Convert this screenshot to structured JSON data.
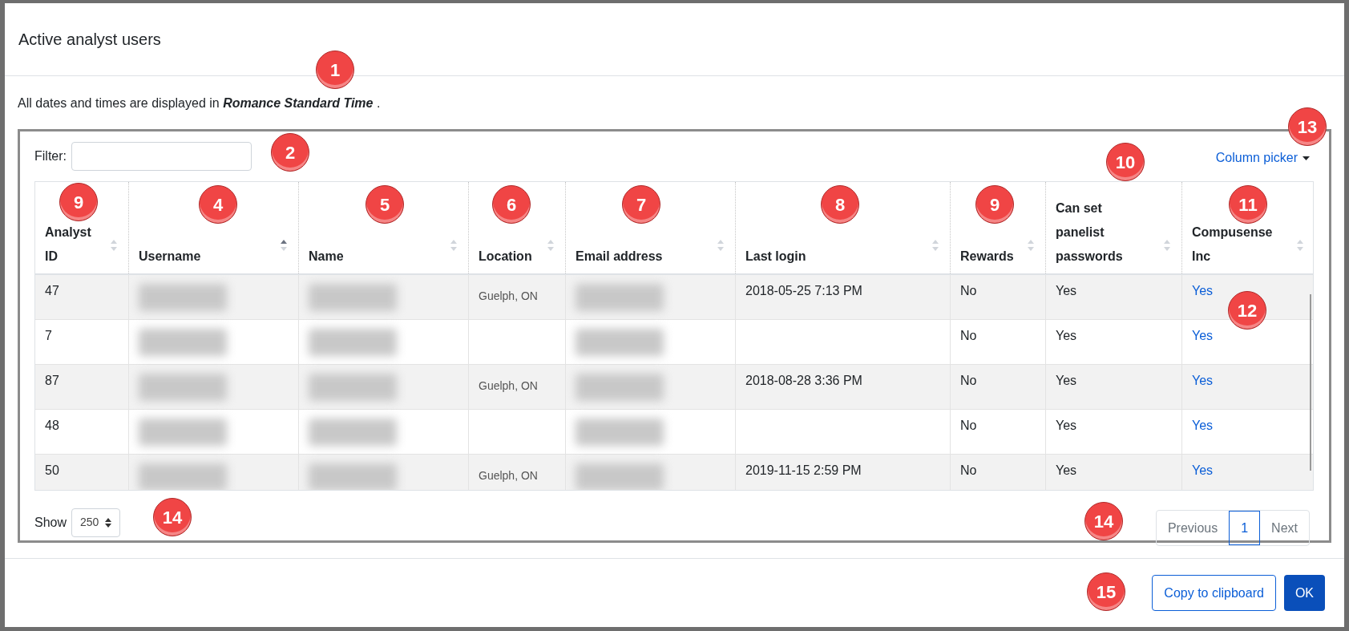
{
  "dialog": {
    "title": "Active analyst users",
    "note": "All dates and times are displayed in **Romance Standard Time** ."
  },
  "filter": {
    "label": "Filter:"
  },
  "column_picker": "Column picker",
  "table": {
    "columns": [
      {
        "label": "Analyst ID",
        "sorted": false
      },
      {
        "label": "Username",
        "sorted": true
      },
      {
        "label": "Name",
        "sorted": false
      },
      {
        "label": "Location",
        "sorted": false
      },
      {
        "label": "Email address",
        "sorted": false
      },
      {
        "label": "Last login",
        "sorted": false
      },
      {
        "label": "Rewards",
        "sorted": false
      },
      {
        "label": "Can set panelist passwords",
        "sorted": false
      },
      {
        "label": "Compusense Inc",
        "sorted": false
      }
    ],
    "rows": [
      {
        "analyst_id": "47",
        "location": "Guelph, ON",
        "last_login": "2018-05-25 7:13 PM",
        "rewards": "No",
        "can_set_panelist_passwords": "Yes",
        "compusense_inc": "Yes"
      },
      {
        "analyst_id": "7",
        "rewards": "No",
        "can_set_panelist_passwords": "Yes",
        "compusense_inc": "Yes"
      },
      {
        "analyst_id": "87",
        "location": "Guelph, ON",
        "last_login": "2018-08-28 3:36 PM",
        "rewards": "No",
        "can_set_panelist_passwords": "Yes",
        "compusense_inc": "Yes"
      },
      {
        "analyst_id": "48",
        "rewards": "No",
        "can_set_panelist_passwords": "Yes",
        "compusense_inc": "Yes"
      },
      {
        "analyst_id": "50",
        "location": "Guelph, ON",
        "last_login": "2019-11-15 2:59 PM",
        "rewards": "No",
        "can_set_panelist_passwords": "Yes",
        "compusense_inc": "Yes"
      }
    ]
  },
  "page_size": {
    "label": "Show",
    "value": "250"
  },
  "pagination": [
    {
      "label": "Previous",
      "disabled": true,
      "selected": false
    },
    {
      "label": "1",
      "disabled": false,
      "selected": true
    },
    {
      "label": "Next",
      "disabled": true,
      "selected": false
    }
  ],
  "buttons": [
    {
      "label": "Copy to clipboard",
      "kind": "secondary"
    },
    {
      "label": "OK",
      "kind": "primary"
    }
  ],
  "callouts": [
    {
      "number": "1"
    },
    {
      "number": "2"
    },
    {
      "number": "13"
    },
    {
      "number": "9"
    },
    {
      "number": "4"
    },
    {
      "number": "5"
    },
    {
      "number": "6"
    },
    {
      "number": "7"
    },
    {
      "number": "8"
    },
    {
      "number": "9"
    },
    {
      "number": "10"
    },
    {
      "number": "11"
    },
    {
      "number": "12"
    },
    {
      "number": "14"
    },
    {
      "number": "14"
    },
    {
      "number": "15"
    }
  ]
}
